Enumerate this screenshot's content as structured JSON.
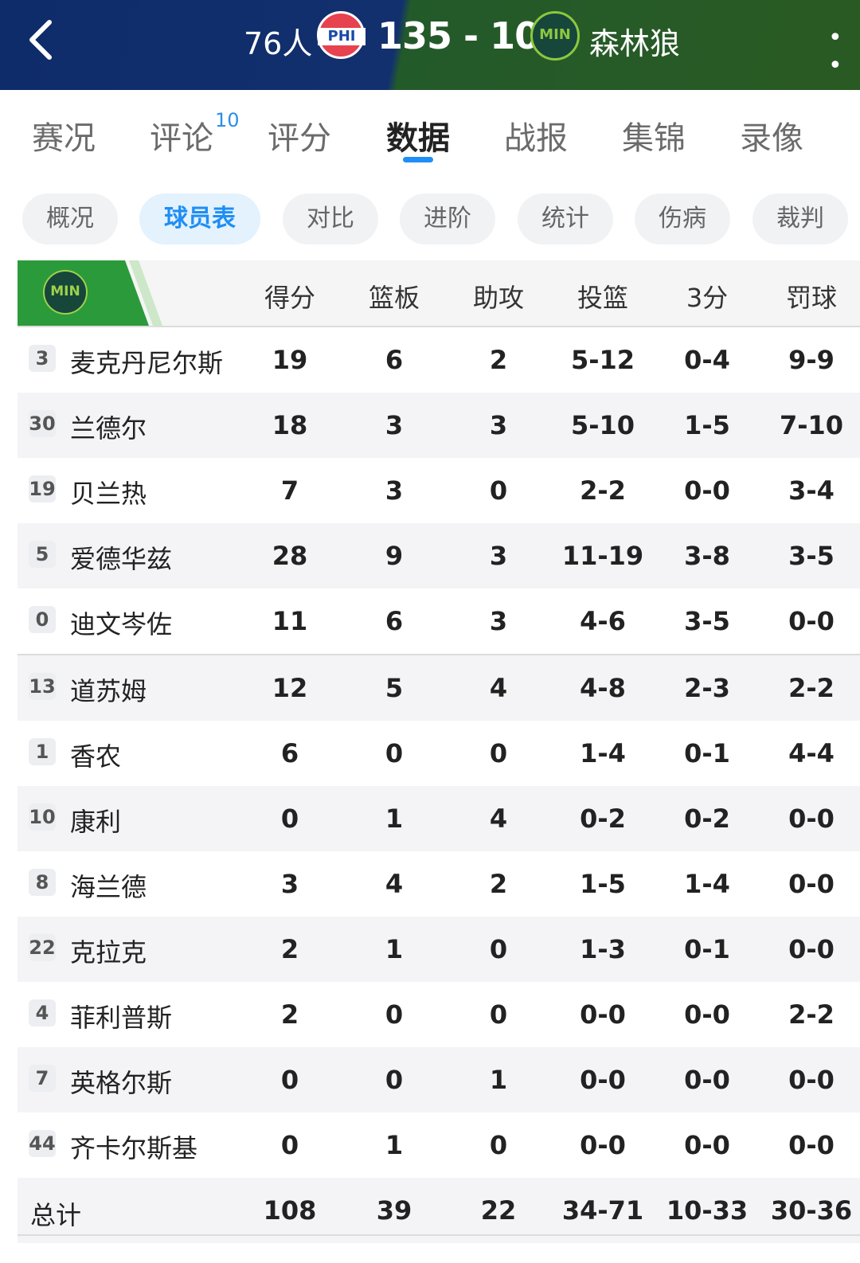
{
  "header": {
    "home_team": "76人",
    "home_abbr": "PHI",
    "score": "135 - 108",
    "away_abbr": "MIN",
    "away_team": "森林狼",
    "more_label": "• •"
  },
  "tabs": [
    {
      "label": "赛况"
    },
    {
      "label": "评论",
      "badge": "10"
    },
    {
      "label": "评分"
    },
    {
      "label": "数据",
      "active": true
    },
    {
      "label": "战报"
    },
    {
      "label": "集锦"
    },
    {
      "label": "录像"
    }
  ],
  "subtabs": [
    {
      "label": "概况"
    },
    {
      "label": "球员表",
      "active": true
    },
    {
      "label": "对比"
    },
    {
      "label": "进阶"
    },
    {
      "label": "统计"
    },
    {
      "label": "伤病"
    },
    {
      "label": "裁判"
    }
  ],
  "table": {
    "team_abbr": "MIN",
    "columns": [
      "得分",
      "篮板",
      "助攻",
      "投篮",
      "3分",
      "罚球"
    ],
    "rows": [
      {
        "num": "3",
        "name": "麦克丹尼尔斯",
        "pts": "19",
        "reb": "6",
        "ast": "2",
        "fg": "5-12",
        "tp": "0-4",
        "ft": "9-9"
      },
      {
        "num": "30",
        "name": "兰德尔",
        "pts": "18",
        "reb": "3",
        "ast": "3",
        "fg": "5-10",
        "tp": "1-5",
        "ft": "7-10"
      },
      {
        "num": "19",
        "name": "贝兰热",
        "pts": "7",
        "reb": "3",
        "ast": "0",
        "fg": "2-2",
        "tp": "0-0",
        "ft": "3-4"
      },
      {
        "num": "5",
        "name": "爱德华兹",
        "pts": "28",
        "reb": "9",
        "ast": "3",
        "fg": "11-19",
        "tp": "3-8",
        "ft": "3-5"
      },
      {
        "num": "0",
        "name": "迪文岑佐",
        "pts": "11",
        "reb": "6",
        "ast": "3",
        "fg": "4-6",
        "tp": "3-5",
        "ft": "0-0"
      },
      {
        "num": "13",
        "name": "道苏姆",
        "pts": "12",
        "reb": "5",
        "ast": "4",
        "fg": "4-8",
        "tp": "2-3",
        "ft": "2-2"
      },
      {
        "num": "1",
        "name": "香农",
        "pts": "6",
        "reb": "0",
        "ast": "0",
        "fg": "1-4",
        "tp": "0-1",
        "ft": "4-4"
      },
      {
        "num": "10",
        "name": "康利",
        "pts": "0",
        "reb": "1",
        "ast": "4",
        "fg": "0-2",
        "tp": "0-2",
        "ft": "0-0"
      },
      {
        "num": "8",
        "name": "海兰德",
        "pts": "3",
        "reb": "4",
        "ast": "2",
        "fg": "1-5",
        "tp": "1-4",
        "ft": "0-0"
      },
      {
        "num": "22",
        "name": "克拉克",
        "pts": "2",
        "reb": "1",
        "ast": "0",
        "fg": "1-3",
        "tp": "0-1",
        "ft": "0-0"
      },
      {
        "num": "4",
        "name": "菲利普斯",
        "pts": "2",
        "reb": "0",
        "ast": "0",
        "fg": "0-0",
        "tp": "0-0",
        "ft": "2-2"
      },
      {
        "num": "7",
        "name": "英格尔斯",
        "pts": "0",
        "reb": "0",
        "ast": "1",
        "fg": "0-0",
        "tp": "0-0",
        "ft": "0-0"
      },
      {
        "num": "44",
        "name": "齐卡尔斯基",
        "pts": "0",
        "reb": "1",
        "ast": "0",
        "fg": "0-0",
        "tp": "0-0",
        "ft": "0-0"
      }
    ],
    "total": {
      "label": "总计",
      "pts": "108",
      "reb": "39",
      "ast": "22",
      "fg": "34-71",
      "tp": "10-33",
      "ft": "30-36"
    }
  }
}
